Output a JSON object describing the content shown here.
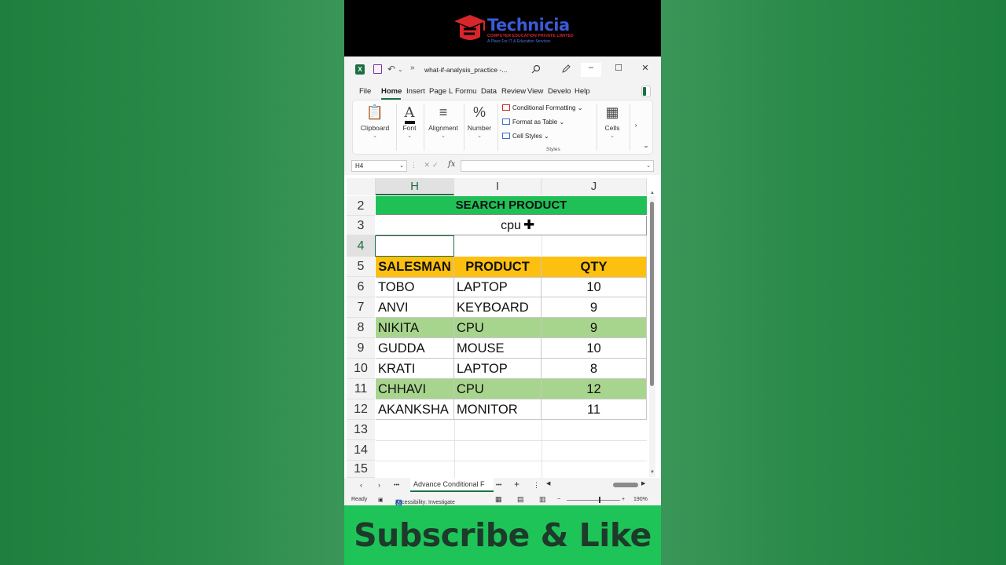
{
  "brand": {
    "name": "Technicia",
    "tagline1": "COMPUTER EDUCATION PRIVATE LIMITED",
    "tagline2": "A Place For IT & Education Services",
    "colors": {
      "accent": "#1d6f42",
      "brand_blue": "#3b5bd6",
      "brand_red": "#d8262c"
    }
  },
  "window": {
    "document_title": "what-if-analysis_practice  -...",
    "overflow_chevrons": "»",
    "undo_chevron": "⌄",
    "icons": [
      "excel-logo-icon",
      "save-icon",
      "undo-icon",
      "search-icon",
      "pen-icon",
      "minimize-icon",
      "maximize-icon",
      "close-icon"
    ]
  },
  "menu": {
    "tabs": [
      "File",
      "Home",
      "Insert",
      "Page L",
      "Formu",
      "Data",
      "Review",
      "View",
      "Develo",
      "Help"
    ],
    "active": "Home"
  },
  "ribbon": {
    "clipboard": "Clipboard",
    "font": "Font",
    "alignment": "Alignment",
    "number": "Number",
    "conditional_formatting": "Conditional Formatting",
    "format_as_table": "Format as Table",
    "cell_styles": "Cell Styles",
    "styles_group": "Styles",
    "cells": "Cells",
    "font_letter": "A",
    "number_symbol": "%",
    "more_chevron": "›",
    "expand_chevron": "⌄"
  },
  "formula_bar": {
    "name_box": "H4",
    "fx": "fx",
    "value": ""
  },
  "grid": {
    "columns": [
      "H",
      "I",
      "J"
    ],
    "selected_column": "H",
    "rows": [
      "2",
      "3",
      "4",
      "5",
      "6",
      "7",
      "8",
      "9",
      "10",
      "11",
      "12",
      "13",
      "14",
      "15"
    ],
    "selected_row": "4",
    "search_title": "SEARCH PRODUCT",
    "search_value": "cpu",
    "table_headers": [
      "SALESMAN",
      "PRODUCT",
      "QTY"
    ],
    "table_rows": [
      {
        "salesman": "TOBO",
        "product": "LAPTOP",
        "qty": "10",
        "highlighted": false
      },
      {
        "salesman": "ANVI",
        "product": "KEYBOARD",
        "qty": "9",
        "highlighted": false
      },
      {
        "salesman": "NIKITA",
        "product": "CPU",
        "qty": "9",
        "highlighted": true
      },
      {
        "salesman": "GUDDA",
        "product": "MOUSE",
        "qty": "10",
        "highlighted": false
      },
      {
        "salesman": "KRATI",
        "product": "LAPTOP",
        "qty": "8",
        "highlighted": false
      },
      {
        "salesman": "CHHAVI",
        "product": "CPU",
        "qty": "12",
        "highlighted": true
      },
      {
        "salesman": "AKANKSHA",
        "product": "MONITOR",
        "qty": "11",
        "highlighted": false
      }
    ],
    "colors": {
      "title_bg": "#1fc157",
      "header_bg": "#fdc010",
      "highlight_bg": "#a8d58d"
    }
  },
  "sheets": {
    "active_tab": "Advance Conditional F",
    "nav_prev": "‹",
    "nav_next": "›",
    "more": "•••",
    "add": "+",
    "options": "⋮"
  },
  "status": {
    "ready": "Ready",
    "accessibility": "Accessibility: Investigate",
    "zoom": "190%",
    "zoom_minus": "−",
    "zoom_plus": "+"
  },
  "footer": {
    "text": "Subscribe & Like"
  }
}
